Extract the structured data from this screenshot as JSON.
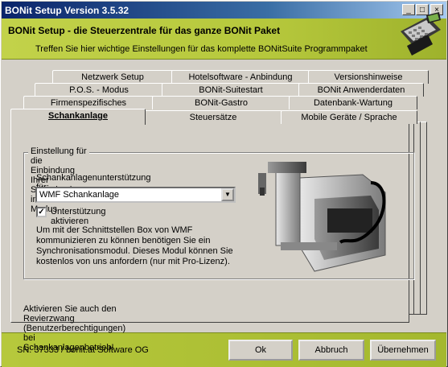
{
  "window": {
    "title": "BONit Setup Version 3.5.32"
  },
  "header": {
    "title": "BONit Setup - die Steuerzentrale für das ganze BONit Paket",
    "subtitle": "Treffen Sie hier wichtige Einstellungen für das komplette BONitSuite Programmpaket"
  },
  "tabs": {
    "row1": [
      "Netzwerk Setup",
      "Hotelsoftware - Anbindung",
      "Versionshinweise"
    ],
    "row2": [
      "P.O.S. - Modus",
      "BONit-Suitestart",
      "BONit Anwenderdaten"
    ],
    "row3": [
      "Firmenspezifisches",
      "BONit-Gastro",
      "Datenbank-Wartung"
    ],
    "row4": [
      "Schankanlage",
      "Steuersätze",
      "Mobile Geräte / Sprache"
    ],
    "active": "Schankanlage"
  },
  "group": {
    "legend": "Einstellung für die Einbindung Ihrer Schankanlage im Debit Modus",
    "select_label": "Schankanlagenunterstützung für:",
    "select_value": "WMF Schankanlage",
    "checkbox_label": "Unterstützung aktivieren",
    "checkbox_checked": true,
    "info_lines": [
      "Um mit der Schnittstellen Box von WMF",
      "kommunizieren zu können benötigen Sie ein",
      "Synchronisationsmodul. Dieses Modul können Sie",
      "kostenlos von uns anfordern (nur mit Pro-Lizenz)."
    ]
  },
  "bottom_note": "Aktivieren Sie auch den Revierzwang (Benutzerberechtigungen) bei Schankanlagenbetrieb!",
  "status": {
    "sn": "SN: 37333 / bonit.at Software OG"
  },
  "buttons": {
    "ok": "Ok",
    "abbruch": "Abbruch",
    "uebernehmen": "Übernehmen"
  },
  "colors": {
    "title_bar": "#0a246a",
    "header_green": "#b6c83c",
    "face": "#d4d0c8"
  }
}
